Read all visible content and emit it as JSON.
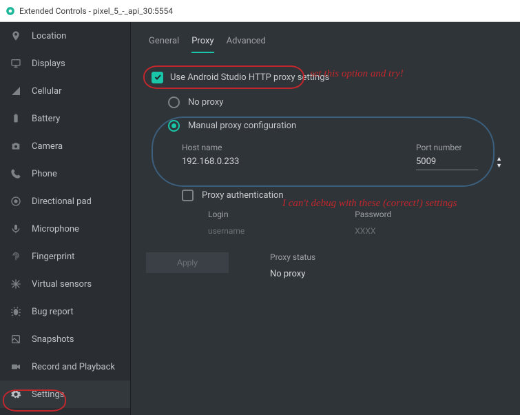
{
  "window": {
    "title": "Extended Controls - pixel_5_-_api_30:5554"
  },
  "sidebar": {
    "items": [
      {
        "label": "Location",
        "icon": "location"
      },
      {
        "label": "Displays",
        "icon": "displays"
      },
      {
        "label": "Cellular",
        "icon": "cellular"
      },
      {
        "label": "Battery",
        "icon": "battery"
      },
      {
        "label": "Camera",
        "icon": "camera"
      },
      {
        "label": "Phone",
        "icon": "phone"
      },
      {
        "label": "Directional pad",
        "icon": "dpad"
      },
      {
        "label": "Microphone",
        "icon": "mic"
      },
      {
        "label": "Fingerprint",
        "icon": "fingerprint"
      },
      {
        "label": "Virtual sensors",
        "icon": "sensors"
      },
      {
        "label": "Bug report",
        "icon": "bug"
      },
      {
        "label": "Snapshots",
        "icon": "snapshot"
      },
      {
        "label": "Record and Playback",
        "icon": "record"
      },
      {
        "label": "Settings",
        "icon": "gear",
        "selected": true
      }
    ]
  },
  "tabs": [
    {
      "label": "General",
      "active": false
    },
    {
      "label": "Proxy",
      "active": true
    },
    {
      "label": "Advanced",
      "active": false
    }
  ],
  "proxy": {
    "use_android_studio_label": "Use Android Studio HTTP proxy settings",
    "use_android_studio_checked": true,
    "no_proxy_label": "No proxy",
    "manual_label": "Manual proxy configuration",
    "manual_selected": true,
    "host_label": "Host name",
    "host_value": "192.168.0.233",
    "port_label": "Port number",
    "port_value": "5009",
    "auth_label": "Proxy authentication",
    "auth_checked": false,
    "login_label": "Login",
    "login_placeholder": "username",
    "password_label": "Password",
    "password_placeholder": "XXXX",
    "apply_label": "Apply",
    "status_label": "Proxy status",
    "status_value": "No proxy"
  },
  "annotations": {
    "text1": "set this option and try!",
    "text2": "I can't debug with these (correct!) settings"
  }
}
